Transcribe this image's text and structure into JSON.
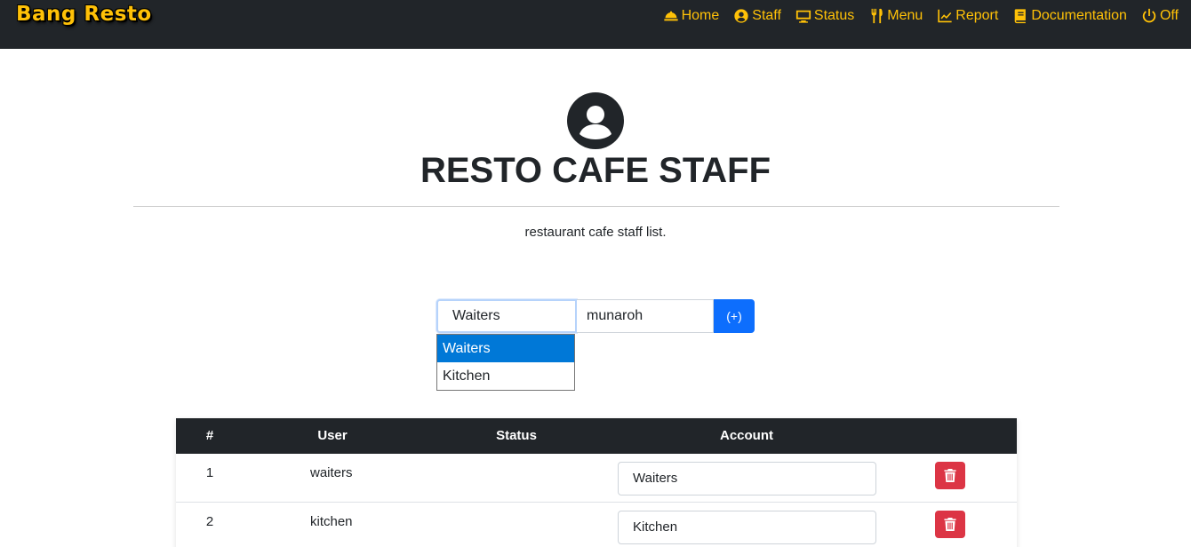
{
  "brand": "Bang Resto",
  "nav": [
    {
      "label": "Home",
      "icon": "bell-concierge-icon"
    },
    {
      "label": "Staff",
      "icon": "user-circle-icon"
    },
    {
      "label": "Status",
      "icon": "monitor-icon"
    },
    {
      "label": "Menu",
      "icon": "utensils-icon"
    },
    {
      "label": "Report",
      "icon": "chart-line-icon"
    },
    {
      "label": "Documentation",
      "icon": "book-icon"
    },
    {
      "label": "Off",
      "icon": "power-icon"
    }
  ],
  "header": {
    "title": "RESTO CAFE STAFF",
    "subtitle": "restaurant cafe staff list."
  },
  "form": {
    "account_value": "Waiters",
    "name_value": "munaroh",
    "add_label": "(+)",
    "options": [
      "Waiters",
      "Kitchen"
    ],
    "selected_option": "Waiters"
  },
  "table": {
    "headers": [
      "#",
      "User",
      "Status",
      "Account"
    ],
    "rows": [
      {
        "num": "1",
        "user": "waiters",
        "status": "",
        "account": "Waiters"
      },
      {
        "num": "2",
        "user": "kitchen",
        "status": "",
        "account": "Kitchen"
      }
    ]
  },
  "colors": {
    "navbar": "#212529",
    "accent": "#ffc107",
    "primary": "#0d6efd",
    "danger": "#dc3545",
    "selected_option": "#0078d7"
  }
}
